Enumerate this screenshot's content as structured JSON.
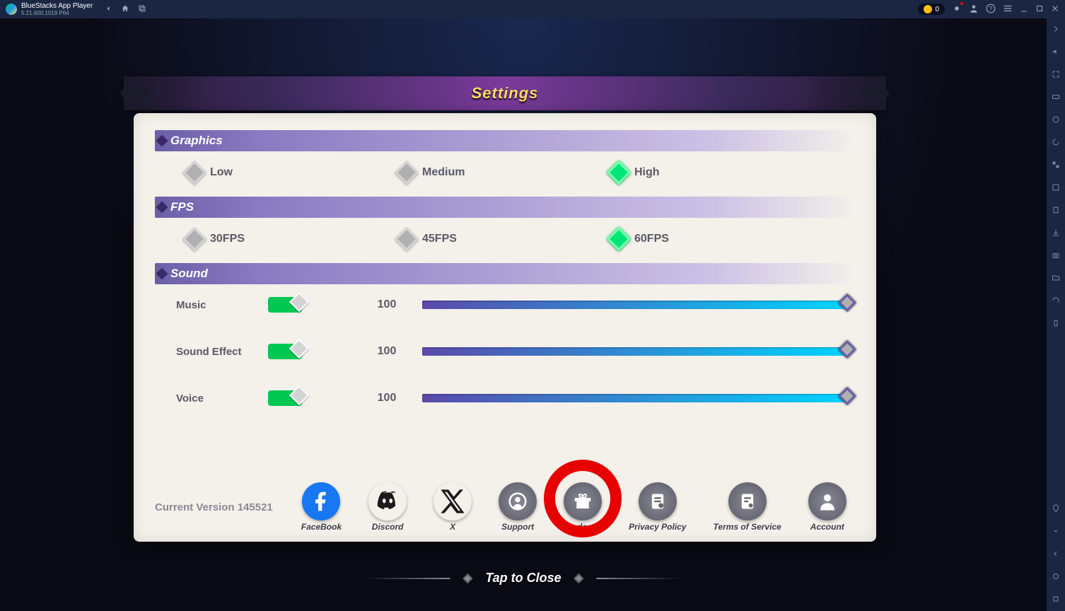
{
  "titlebar": {
    "app_name": "BlueStacks App Player",
    "version_sub": "5.21.600.1019  P64",
    "coin_count": "0"
  },
  "panel": {
    "title": "Settings",
    "graphics_label": "Graphics",
    "graphics_options": {
      "low": "Low",
      "medium": "Medium",
      "high": "High"
    },
    "graphics_selected": "high",
    "fps_label": "FPS",
    "fps_options": {
      "o30": "30FPS",
      "o45": "45FPS",
      "o60": "60FPS"
    },
    "fps_selected": "o60",
    "sound_label": "Sound",
    "sound": {
      "music_label": "Music",
      "music_value": "100",
      "sfx_label": "Sound Effect",
      "sfx_value": "100",
      "voice_label": "Voice",
      "voice_value": "100"
    },
    "version_prefix": "Current Version  ",
    "version_number": "145521",
    "social": {
      "facebook": "FaceBook",
      "discord": "Discord",
      "x": "X",
      "support": "Support",
      "redeem": "Redeem",
      "privacy": "Privacy Policy",
      "tos": "Terms of Service",
      "account": "Account"
    },
    "tap_close": "Tap to Close"
  }
}
